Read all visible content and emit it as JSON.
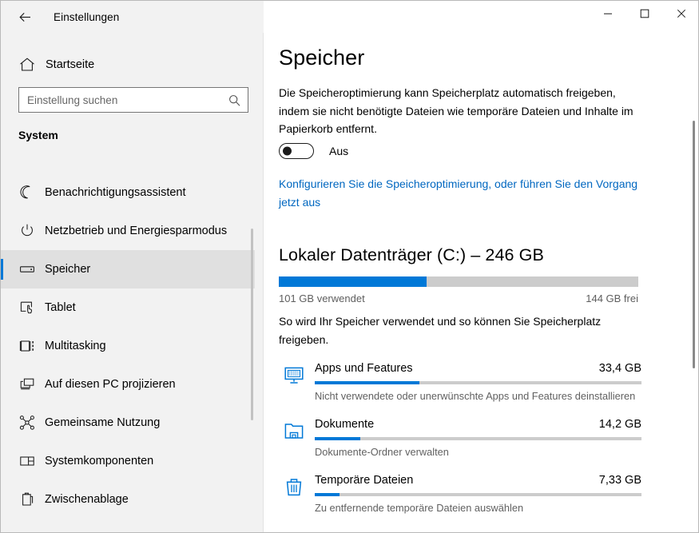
{
  "window": {
    "title": "Einstellungen",
    "back_icon": "back-arrow-icon",
    "minimize_label": "─",
    "maximize_label": "□",
    "close_label": "✕"
  },
  "sidebar": {
    "home_label": "Startseite",
    "home_icon": "home-icon",
    "search": {
      "placeholder": "Einstellung suchen",
      "value": "",
      "icon": "search-icon"
    },
    "section_header": "System",
    "items": [
      {
        "label": "Benachrichtigungsassistent",
        "icon": "moon-icon",
        "selected": false
      },
      {
        "label": "Netzbetrieb und Energiesparmodus",
        "icon": "power-icon",
        "selected": false
      },
      {
        "label": "Speicher",
        "icon": "storage-drive-icon",
        "selected": true
      },
      {
        "label": "Tablet",
        "icon": "tablet-icon",
        "selected": false
      },
      {
        "label": "Multitasking",
        "icon": "multitasking-icon",
        "selected": false
      },
      {
        "label": "Auf diesen PC projizieren",
        "icon": "project-screen-icon",
        "selected": false
      },
      {
        "label": "Gemeinsame Nutzung",
        "icon": "share-nodes-icon",
        "selected": false
      },
      {
        "label": "Systemkomponenten",
        "icon": "system-components-icon",
        "selected": false
      },
      {
        "label": "Zwischenablage",
        "icon": "clipboard-icon",
        "selected": false
      }
    ]
  },
  "main": {
    "page_title": "Speicher",
    "storage_sense": {
      "description": "Die Speicheroptimierung kann Speicherplatz automatisch freigeben, indem sie nicht benötigte Dateien wie temporäre Dateien und Inhalte im Papierkorb entfernt.",
      "toggle_state": "Aus",
      "toggle_on": false,
      "link_text": "Konfigurieren Sie die Speicheroptimierung, oder führen Sie den Vorgang jetzt aus"
    },
    "drive": {
      "title": "Lokaler Datenträger (C:) – 246 GB",
      "used_label": "101 GB verwendet",
      "free_label": "144 GB frei",
      "used_percent": 41,
      "usage_description": "So wird Ihr Speicher verwendet und so können Sie Speicherplatz freigeben."
    },
    "categories": [
      {
        "name": "Apps und Features",
        "size": "33,4 GB",
        "percent": 32,
        "subtitle": "Nicht verwendete oder unerwünschte Apps und Features deinstallieren",
        "icon": "apps-features-icon"
      },
      {
        "name": "Dokumente",
        "size": "14,2 GB",
        "percent": 14,
        "subtitle": "Dokumente-Ordner verwalten",
        "icon": "documents-folder-icon"
      },
      {
        "name": "Temporäre Dateien",
        "size": "7,33 GB",
        "percent": 7.5,
        "subtitle": "Zu entfernende temporäre Dateien auswählen",
        "icon": "trash-bin-icon"
      }
    ]
  },
  "colors": {
    "accent": "#0078d7",
    "link": "#0067c0",
    "sidebar_bg": "#f2f2f2",
    "track": "#cccccc"
  }
}
